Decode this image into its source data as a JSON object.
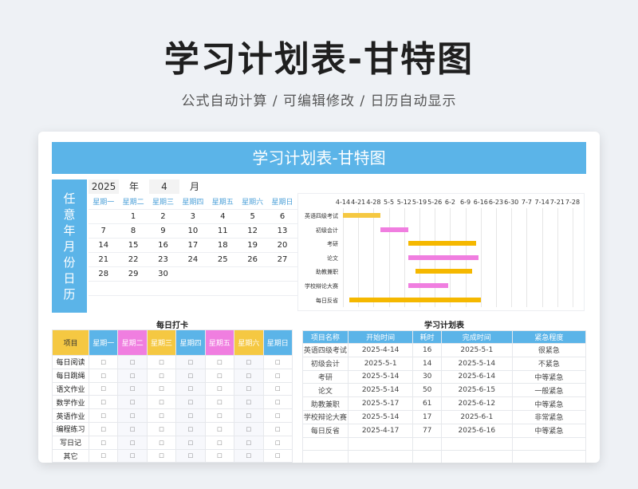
{
  "header": {
    "title": "学习计划表-甘特图",
    "subtitle": "公式自动计算 /  可编辑修改  / 日历自动显示"
  },
  "sheet": {
    "title": "学习计划表-甘特图"
  },
  "calendar": {
    "side_label": [
      "任",
      "意",
      "年",
      "月",
      "份",
      "日",
      "历"
    ],
    "year": "2025",
    "year_label": "年",
    "month": "4",
    "month_label": "月",
    "weekdays": [
      "星期一",
      "星期二",
      "星期三",
      "星期四",
      "星期五",
      "星期六",
      "星期日"
    ],
    "weeks": [
      [
        "",
        "1",
        "2",
        "3",
        "4",
        "5",
        "6"
      ],
      [
        "7",
        "8",
        "9",
        "10",
        "11",
        "12",
        "13"
      ],
      [
        "14",
        "15",
        "16",
        "17",
        "18",
        "19",
        "20"
      ],
      [
        "21",
        "22",
        "23",
        "24",
        "25",
        "26",
        "27"
      ],
      [
        "28",
        "29",
        "30",
        "",
        "",
        "",
        ""
      ],
      [
        "",
        "",
        "",
        "",
        "",
        "",
        ""
      ]
    ]
  },
  "gantt": {
    "axis": [
      "4-14",
      "4-21",
      "4-28",
      "5-5",
      "5-12",
      "5-19",
      "5-26",
      "6-2",
      "6-9",
      "6-16",
      "6-23",
      "6-30",
      "7-7",
      "7-14",
      "7-21",
      "7-28"
    ],
    "tasks": [
      {
        "name": "英语四级考试",
        "start": "2025-4-14",
        "end": "2025-5-1",
        "color": "#f5c842"
      },
      {
        "name": "初级会计",
        "start": "2025-5-1",
        "end": "2025-5-14",
        "color": "#f07ee0"
      },
      {
        "name": "考研",
        "start": "2025-5-14",
        "end": "2025-6-14",
        "color": "#f5b800"
      },
      {
        "name": "论文",
        "start": "2025-5-14",
        "end": "2025-6-15",
        "color": "#f07ee0"
      },
      {
        "name": "助教兼职",
        "start": "2025-5-17",
        "end": "2025-6-12",
        "color": "#f5b800"
      },
      {
        "name": "学校辩论大赛",
        "start": "2025-5-14",
        "end": "2025-6-1",
        "color": "#f07ee0"
      },
      {
        "name": "每日反省",
        "start": "2025-4-17",
        "end": "2025-6-16",
        "color": "#f5b800"
      }
    ]
  },
  "checkin": {
    "title": "每日打卡",
    "corner": "项目",
    "days": [
      {
        "label": "星期一",
        "color": "#5bb4e8"
      },
      {
        "label": "星期二",
        "color": "#f07ee0"
      },
      {
        "label": "星期三",
        "color": "#f5c842"
      },
      {
        "label": "星期四",
        "color": "#5bb4e8"
      },
      {
        "label": "星期五",
        "color": "#f07ee0"
      },
      {
        "label": "星期六",
        "color": "#f5c842"
      },
      {
        "label": "星期日",
        "color": "#5bb4e8"
      }
    ],
    "items": [
      "每日阅读",
      "每日跳绳",
      "语文作业",
      "数学作业",
      "英语作业",
      "编程练习",
      "写日记",
      "其它"
    ],
    "box_symbol": "□"
  },
  "plan": {
    "title": "学习计划表",
    "columns": [
      "项目名称",
      "开始时间",
      "耗时",
      "完成时间",
      "紧急程度"
    ],
    "rows": [
      [
        "英语四级考试",
        "2025-4-14",
        "16",
        "2025-5-1",
        "很紧急"
      ],
      [
        "初级会计",
        "2025-5-1",
        "14",
        "2025-5-14",
        "不紧急"
      ],
      [
        "考研",
        "2025-5-14",
        "30",
        "2025-6-14",
        "中等紧急"
      ],
      [
        "论文",
        "2025-5-14",
        "50",
        "2025-6-15",
        "一般紧急"
      ],
      [
        "助教兼职",
        "2025-5-17",
        "61",
        "2025-6-12",
        "中等紧急"
      ],
      [
        "学校辩论大赛",
        "2025-5-14",
        "17",
        "2025-6-1",
        "非常紧急"
      ],
      [
        "每日反省",
        "2025-4-17",
        "77",
        "2025-6-16",
        "中等紧急"
      ],
      [
        "",
        "",
        "",
        "",
        ""
      ],
      [
        "",
        "",
        "",
        "",
        ""
      ]
    ]
  }
}
